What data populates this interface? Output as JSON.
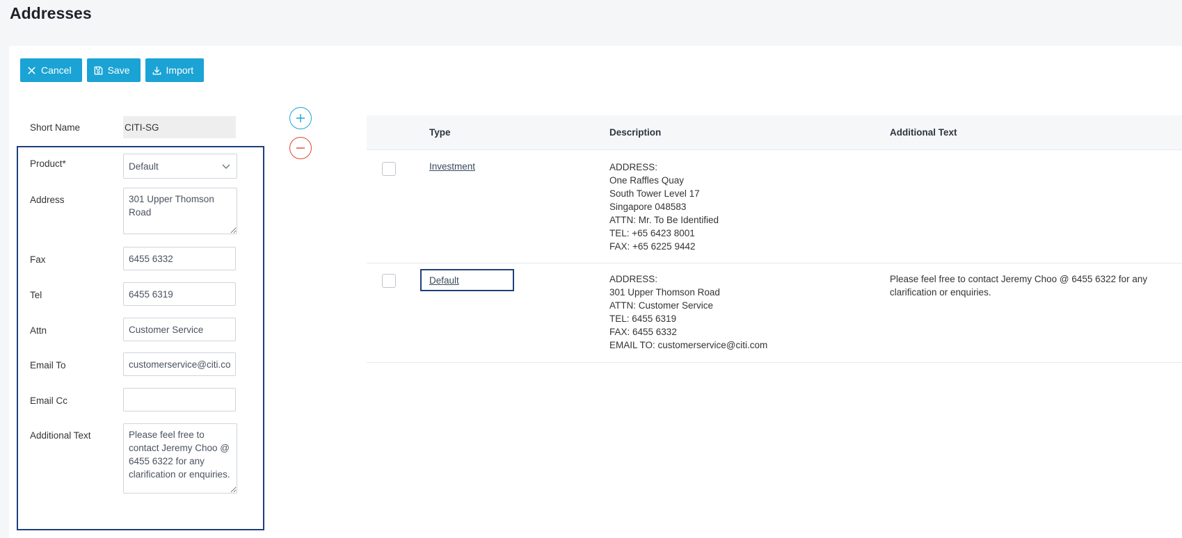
{
  "page": {
    "title": "Addresses"
  },
  "toolbar": {
    "cancel_label": "Cancel",
    "save_label": "Save",
    "import_label": "Import"
  },
  "form": {
    "short_name": {
      "label": "Short Name",
      "value": "CITI-SG"
    },
    "product": {
      "label": "Product*",
      "value": "Default"
    },
    "address": {
      "label": "Address",
      "value": "301 Upper Thomson Road"
    },
    "fax": {
      "label": "Fax",
      "value": "6455 6332"
    },
    "tel": {
      "label": "Tel",
      "value": "6455 6319"
    },
    "attn": {
      "label": "Attn",
      "value": "Customer Service"
    },
    "email_to": {
      "label": "Email To",
      "value": "customerservice@citi.com"
    },
    "email_cc": {
      "label": "Email Cc",
      "value": ""
    },
    "additional_text": {
      "label": "Additional Text",
      "value": "Please feel free to contact Jeremy Choo @ 6455 6322 for any clarification or enquiries."
    }
  },
  "table": {
    "columns": [
      "Type",
      "Description",
      "Additional Text"
    ],
    "rows": [
      {
        "type": "Investment",
        "description": [
          "ADDRESS:",
          "One Raffles Quay",
          "South Tower Level 17",
          "Singapore 048583",
          "ATTN: Mr. To Be Identified",
          "TEL: +65 6423 8001",
          "FAX: +65 6225 9442"
        ],
        "additional_text": ""
      },
      {
        "type": "Default",
        "description": [
          "ADDRESS:",
          "301 Upper Thomson Road",
          "ATTN: Customer Service",
          "TEL: 6455 6319",
          "FAX: 6455 6332",
          "EMAIL TO: customerservice@citi.com"
        ],
        "additional_text": "Please feel free to contact Jeremy Choo @ 6455 6322 for any clarification or enquiries."
      }
    ]
  },
  "icons": {
    "cancel": "close-icon",
    "save": "floppy-disk-icon",
    "import": "download-icon",
    "add": "plus-icon",
    "remove": "minus-icon",
    "dropdown": "chevron-down-icon"
  },
  "colors": {
    "primary": "#1aa3d4",
    "danger": "#e0442f",
    "focus_border": "#1e3f7a"
  }
}
